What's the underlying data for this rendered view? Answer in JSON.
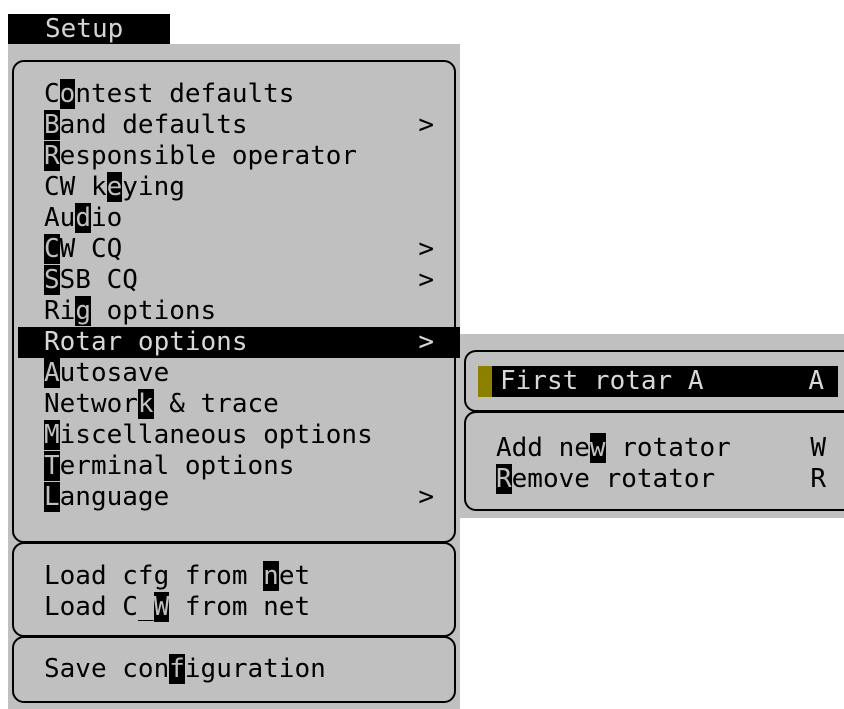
{
  "menu_title": "Setup",
  "main_menu": {
    "items": [
      {
        "pre": "C",
        "key": "o",
        "post": "ntest defaults",
        "arrow": ""
      },
      {
        "pre": "",
        "key": "B",
        "post": "and defaults",
        "arrow": ">"
      },
      {
        "pre": "",
        "key": "R",
        "post": "esponsible operator",
        "arrow": ""
      },
      {
        "pre": "CW k",
        "key": "e",
        "post": "ying",
        "arrow": ""
      },
      {
        "pre": "Au",
        "key": "d",
        "post": "io",
        "arrow": ""
      },
      {
        "pre": "",
        "key": "C",
        "post": "W CQ",
        "arrow": ">"
      },
      {
        "pre": "",
        "key": "S",
        "post": "SB CQ",
        "arrow": ">"
      },
      {
        "pre": "Ri",
        "key": "g",
        "post": " options",
        "arrow": ""
      },
      {
        "pre": "Rotar options",
        "key": "",
        "post": "",
        "arrow": ">"
      },
      {
        "pre": "",
        "key": "A",
        "post": "utosave",
        "arrow": ""
      },
      {
        "pre": "Networ",
        "key": "k",
        "post": " & trace",
        "arrow": ""
      },
      {
        "pre": "",
        "key": "M",
        "post": "iscellaneous options",
        "arrow": ""
      },
      {
        "pre": "",
        "key": "T",
        "post": "erminal options",
        "arrow": ""
      },
      {
        "pre": "",
        "key": "L",
        "post": "anguage",
        "arrow": ">"
      }
    ],
    "net_items": [
      {
        "pre": "Load cfg from ",
        "key": "n",
        "post": "et"
      },
      {
        "pre": "Load C_",
        "key": "W",
        "post": " from net"
      }
    ],
    "save_item": {
      "pre": "Save con",
      "key": "f",
      "post": "iguration"
    }
  },
  "submenu": {
    "selected": {
      "label": "First rotar A",
      "shortcut": "A"
    },
    "items": [
      {
        "pre": "Add ne",
        "key": "w",
        "post": " rotator",
        "shortcut": "W"
      },
      {
        "pre": "",
        "key": "R",
        "post": "emove rotator",
        "shortcut": "R"
      }
    ]
  }
}
